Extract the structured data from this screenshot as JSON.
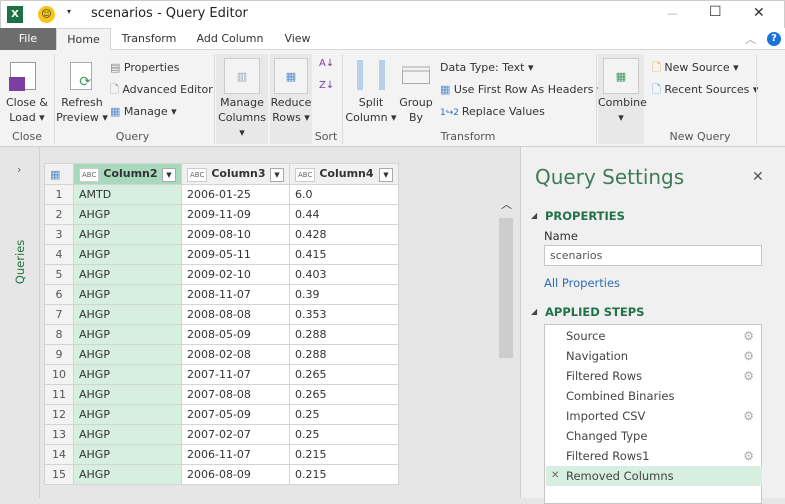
{
  "window": {
    "title": "scenarios - Query Editor",
    "minimize": "—",
    "maximize": "☐",
    "close": "✕"
  },
  "tabs": [
    {
      "label": "File"
    },
    {
      "label": "Home"
    },
    {
      "label": "Transform"
    },
    {
      "label": "Add Column"
    },
    {
      "label": "View"
    }
  ],
  "ribbon": {
    "close_load": "Close &",
    "close_load2": "Load ▾",
    "group_close": "Close",
    "refresh": "Refresh",
    "refresh2": "Preview ▾",
    "properties": "Properties",
    "advanced_editor": "Advanced Editor",
    "manage": "Manage ▾",
    "group_query": "Query",
    "manage_columns": "Manage",
    "manage_columns2": "Columns ▾",
    "reduce_rows": "Reduce",
    "reduce_rows2": "Rows ▾",
    "group_sort": "Sort",
    "split_column": "Split",
    "split_column2": "Column ▾",
    "group_by": "Group",
    "group_by2": "By",
    "data_type": "Data Type: Text ▾",
    "first_row": "Use First Row As Headers ▾",
    "replace_values": "Replace Values",
    "group_transform": "Transform",
    "combine": "Combine",
    "combine2": "▾",
    "new_source": "New Source ▾",
    "recent_sources": "Recent Sources ▾",
    "group_new_query": "New Query"
  },
  "left_pane": {
    "label": "Queries",
    "expand": "›"
  },
  "table": {
    "columns": [
      "Column2",
      "Column3",
      "Column4"
    ],
    "type_badge": "ABC",
    "rows": [
      [
        "1",
        "AMTD",
        "2006-01-25",
        "6.0"
      ],
      [
        "2",
        "AHGP",
        "2009-11-09",
        "0.44"
      ],
      [
        "3",
        "AHGP",
        "2009-08-10",
        "0.428"
      ],
      [
        "4",
        "AHGP",
        "2009-05-11",
        "0.415"
      ],
      [
        "5",
        "AHGP",
        "2009-02-10",
        "0.403"
      ],
      [
        "6",
        "AHGP",
        "2008-11-07",
        "0.39"
      ],
      [
        "7",
        "AHGP",
        "2008-08-08",
        "0.353"
      ],
      [
        "8",
        "AHGP",
        "2008-05-09",
        "0.288"
      ],
      [
        "9",
        "AHGP",
        "2008-02-08",
        "0.288"
      ],
      [
        "10",
        "AHGP",
        "2007-11-07",
        "0.265"
      ],
      [
        "11",
        "AHGP",
        "2007-08-08",
        "0.265"
      ],
      [
        "12",
        "AHGP",
        "2007-05-09",
        "0.25"
      ],
      [
        "13",
        "AHGP",
        "2007-02-07",
        "0.25"
      ],
      [
        "14",
        "AHGP",
        "2006-11-07",
        "0.215"
      ],
      [
        "15",
        "AHGP",
        "2006-08-09",
        "0.215"
      ]
    ]
  },
  "settings": {
    "title": "Query Settings",
    "close": "✕",
    "properties_header": "PROPERTIES",
    "name_label": "Name",
    "name_value": "scenarios",
    "all_properties": "All Properties",
    "steps_header": "APPLIED STEPS",
    "steps": [
      {
        "label": "Source",
        "gear": true
      },
      {
        "label": "Navigation",
        "gear": true
      },
      {
        "label": "Filtered Rows",
        "gear": true
      },
      {
        "label": "Combined Binaries",
        "gear": false
      },
      {
        "label": "Imported CSV",
        "gear": true
      },
      {
        "label": "Changed Type",
        "gear": false
      },
      {
        "label": "Filtered Rows1",
        "gear": true
      },
      {
        "label": "Removed Columns",
        "gear": false,
        "selected": true
      }
    ]
  },
  "colors": {
    "accent": "#217346",
    "selected": "#d6efe1",
    "header_selected": "#a9d9bd"
  }
}
